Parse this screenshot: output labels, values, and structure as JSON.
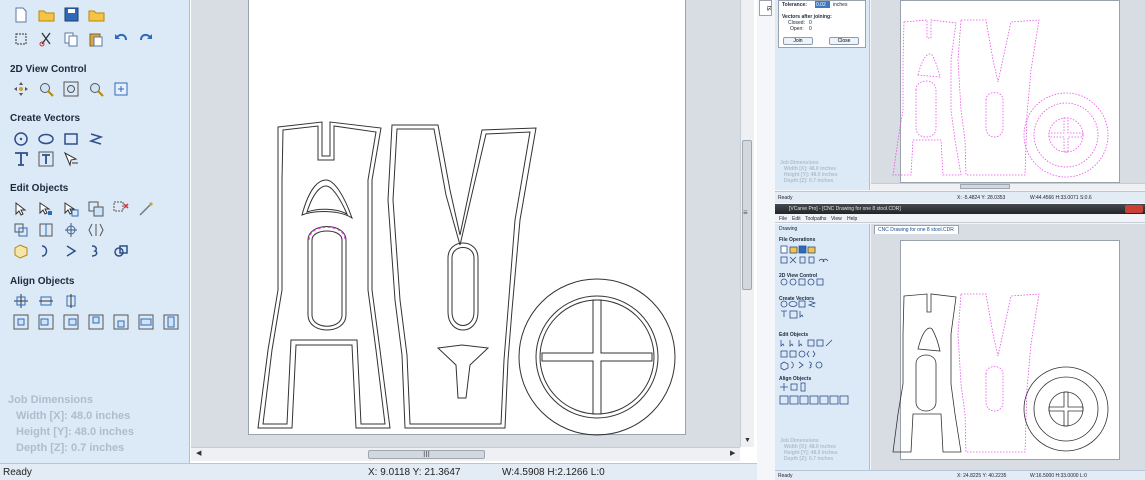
{
  "left_panel": {
    "sections": [
      {
        "title": "2D View Control"
      },
      {
        "title": "Create Vectors"
      },
      {
        "title": "Edit Objects"
      },
      {
        "title": "Align Objects"
      }
    ],
    "job_dimensions": {
      "title": "Job Dimensions",
      "width": "Width  [X]: 48.0 inches",
      "height": "Height [Y]: 48.0 inches",
      "depth": "Depth  [Z]: 0.7 inches"
    }
  },
  "status_bar": {
    "state": "Ready",
    "coords": "X: 9.0118 Y: 21.3647",
    "size": "W:4.5908  H:2.1266  L:0"
  },
  "scrollbar": {
    "thumb_label": "III"
  },
  "top_right_window": {
    "side_tab": "ts",
    "tolerance_label": "Tolerance:",
    "tolerance_value": "0.02",
    "units": "inches",
    "vectors_after_joining": "Vectors after joining:",
    "closed_label": "Closed:",
    "closed_value": "0",
    "open_label": "Open:",
    "open_value": "0",
    "join_button": "Join",
    "close_button": "Close",
    "job_dimensions": [
      "Job Dimensions",
      "Width  [X]: 48.0 inches",
      "Height [Y]: 48.0 inches",
      "Depth  [Z]: 0.7 inches"
    ],
    "status_state": "Ready",
    "status_coords": "X: -5.4824 Y: 28.0353",
    "status_size": "W:44.4566  H:33.0071  S:0.6"
  },
  "bottom_right_window": {
    "title": "[VCarve Pro] - [CNC Drawing for one 8 stool.CDR]",
    "menu": [
      "File",
      "Edit",
      "Toolpaths",
      "View",
      "Help"
    ],
    "drawing_tab": "Drawing",
    "doc_tab": "CNC Drawing for one 8 stool.CDR",
    "sections": [
      "File Operations",
      "2D View Control",
      "Create Vectors",
      "Edit Objects",
      "Align Objects"
    ],
    "job_dimensions": [
      "Job Dimensions",
      "Width  [X]: 48.0 inches",
      "Height [Y]: 48.0 inches",
      "Depth  [Z]: 0.7 inches"
    ],
    "status_state": "Ready",
    "status_coords": "X: 24.8225 Y: 40.2235",
    "status_size": "W:16.5000  H:33.0000  L:0"
  },
  "colors": {
    "panel_bg": "#dce9f6",
    "vector_stroke": "#333333",
    "selection_pink": "#e84ee8"
  }
}
